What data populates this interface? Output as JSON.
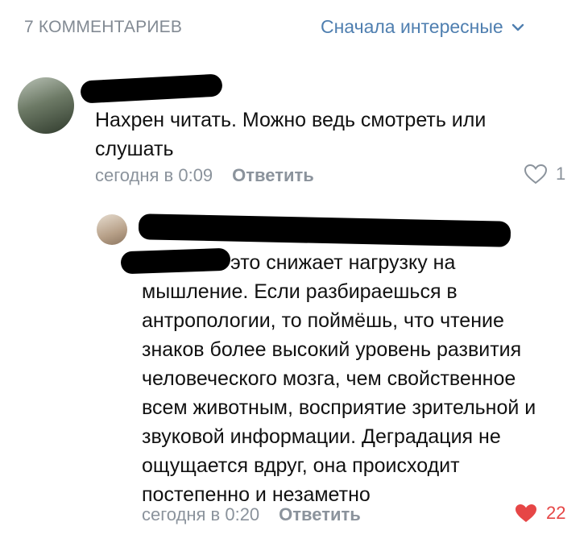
{
  "header": {
    "count_label": "7 КОММЕНТАРИЕВ",
    "sort_label": "Сначала интересные",
    "sort_icon": "chevron-down-icon"
  },
  "colors": {
    "accent": "#4f7fb0",
    "muted": "#8b939c",
    "like_active": "#e64646"
  },
  "comments": [
    {
      "text": "Нахрен читать. Можно ведь смотреть или слушать",
      "time": "сегодня в 0:09",
      "reply_label": "Ответить",
      "likes": "1",
      "liked": false
    },
    {
      "text": "это снижает нагрузку на мышление. Если разбираешься в антропологии, то поймёшь, что чтение знаков более высокий уровень развития человеческого мозга, чем свойственное всем животным, восприятие зрительной и звуковой информации. Деградация не ощущается вдруг, она происходит постепенно и незаметно",
      "time": "сегодня в 0:20",
      "reply_label": "Ответить",
      "likes": "22",
      "liked": true
    }
  ]
}
